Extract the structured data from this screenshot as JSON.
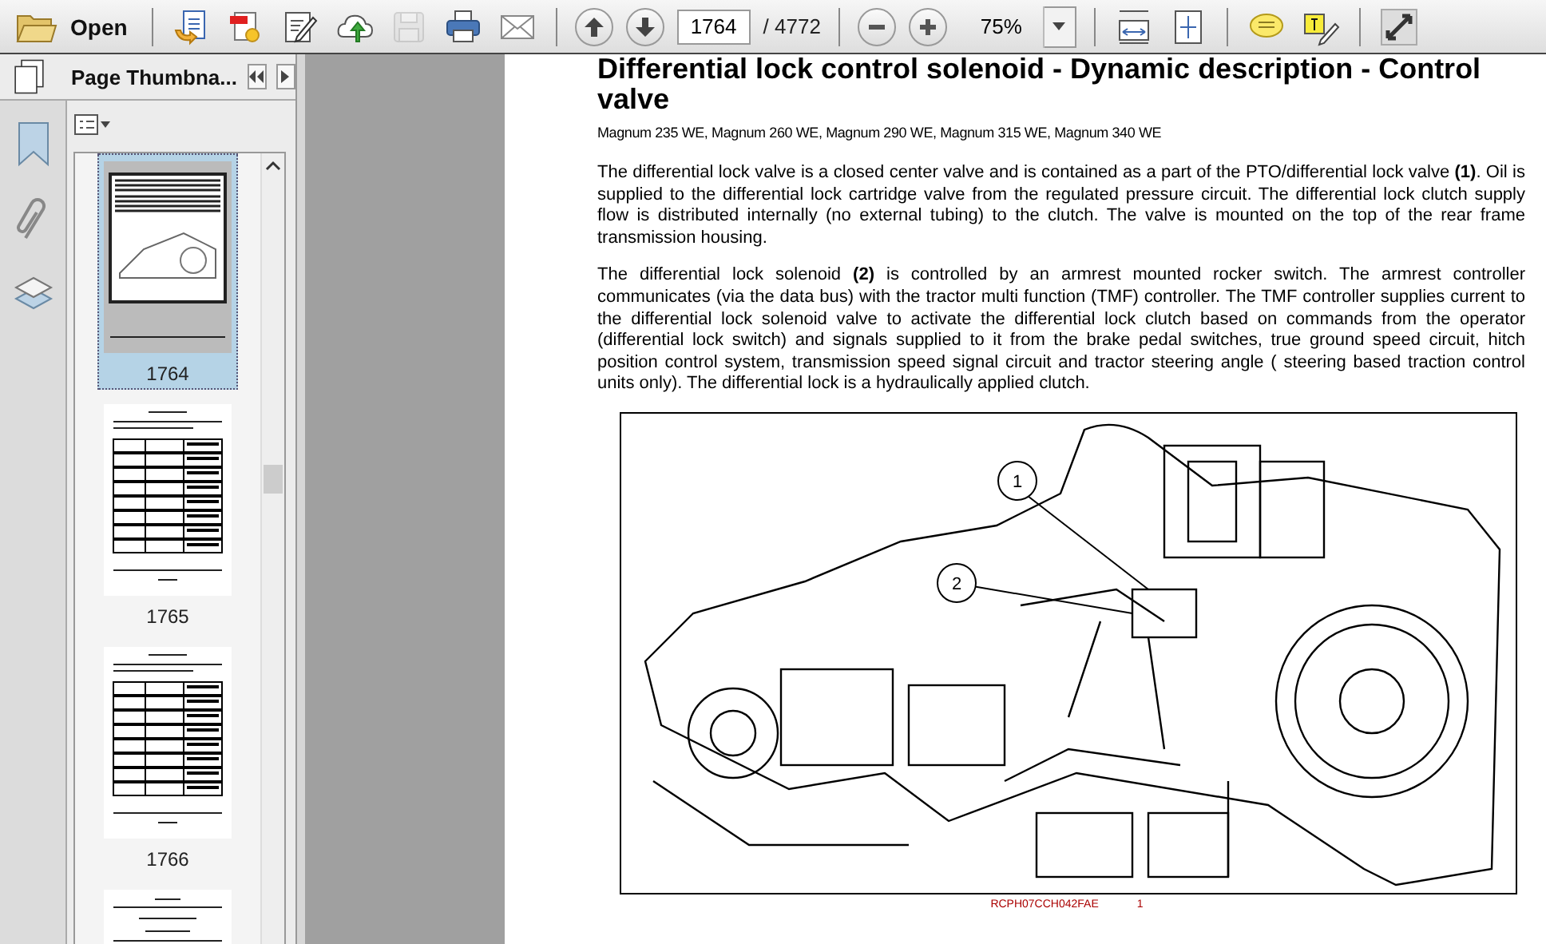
{
  "toolbar": {
    "open_label": "Open",
    "buttons": [
      {
        "kind": "create",
        "disabled": false
      },
      {
        "kind": "convert",
        "disabled": false
      },
      {
        "kind": "edit",
        "disabled": false
      },
      {
        "kind": "upload",
        "disabled": false
      },
      {
        "kind": "save",
        "disabled": true
      },
      {
        "kind": "print",
        "disabled": false
      },
      {
        "kind": "mail",
        "disabled": false
      }
    ],
    "page_field": {
      "value": "1764"
    },
    "page_total": "/ 4772",
    "zoom_field": {
      "value": "75%"
    }
  },
  "sidebar": {
    "panel_title": "Page Thumbna...",
    "thumbnails": [
      {
        "label": "1764",
        "selected": true,
        "kind": "figure"
      },
      {
        "label": "1765",
        "selected": false,
        "kind": "table"
      },
      {
        "label": "1766",
        "selected": false,
        "kind": "table"
      },
      {
        "selected": false,
        "kind": "text"
      }
    ]
  },
  "document": {
    "heading": "Differential lock control solenoid - Dynamic description - Control valve",
    "models": "Magnum 235 WE, Magnum 260 WE, Magnum 290 WE, Magnum 315 WE, Magnum 340 WE",
    "paragraphs": [
      "The differential lock valve is a closed center valve and is contained as a part of the PTO/differential lock valve **(1)**. Oil is supplied to the differential lock cartridge valve from the regulated pressure circuit. The differential lock clutch supply flow is distributed internally (no external tubing) to the clutch. The valve is mounted on the top of the rear frame transmission housing.",
      "The differential lock solenoid **(2)** is controlled by an armrest mounted rocker switch. The armrest controller communicates (via the data bus) with the tractor multi function (TMF) controller. The TMF controller supplies current to the differential lock solenoid valve to activate the differential lock clutch based on commands from the operator (differential lock switch) and signals supplied to it from the brake pedal switches, true ground speed circuit, hitch position control system, transmission speed signal circuit and tractor steering angle ( steering based traction control units only). The differential lock is a hydraulically applied clutch."
    ],
    "figure": {
      "callouts": [
        "1",
        "2"
      ],
      "caption_code": "RCPH07CCH042FAE",
      "caption_number": "1"
    }
  }
}
